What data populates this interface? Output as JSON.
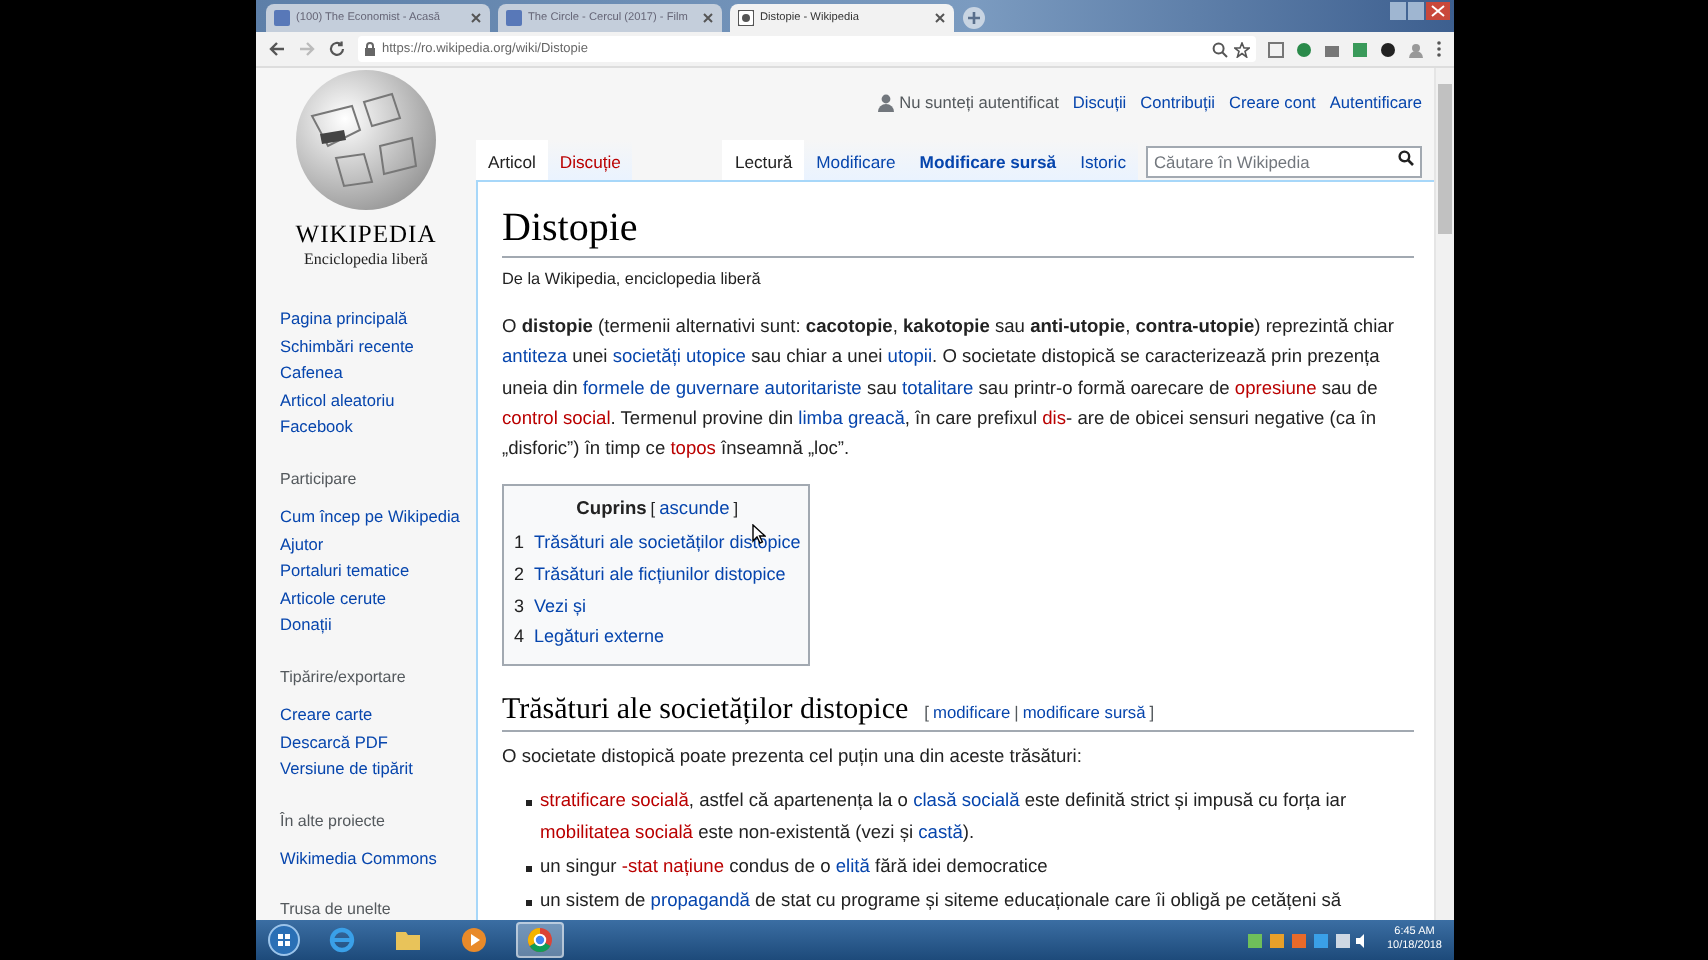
{
  "browser": {
    "tabs": [
      {
        "title": "(100) The Economist - Acasă",
        "selected": false
      },
      {
        "title": "The Circle - Cercul (2017) - Film",
        "selected": false
      },
      {
        "title": "Distopie - Wikipedia",
        "selected": true
      }
    ],
    "url": "https://ro.wikipedia.org/wiki/Distopie"
  },
  "logo": {
    "wordmark": "WIKIPEDIA",
    "tagline": "Enciclopedia liberă"
  },
  "sidebar": {
    "sections": [
      {
        "items": [
          "Pagina principală",
          "Schimbări recente",
          "Cafenea",
          "Articol aleatoriu",
          "Facebook"
        ]
      },
      {
        "heading": "Participare",
        "items": [
          "Cum încep pe Wikipedia",
          "Ajutor",
          "Portaluri tematice",
          "Articole cerute",
          "Donații"
        ]
      },
      {
        "heading": "Tipărire/exportare",
        "items": [
          "Creare carte",
          "Descarcă PDF",
          "Versiune de tipărit"
        ]
      },
      {
        "heading": "În alte proiecte",
        "items": [
          "Wikimedia Commons"
        ]
      },
      {
        "heading": "Trusa de unelte"
      }
    ]
  },
  "personal": {
    "status": "Nu sunteți autentificat",
    "links": [
      "Discuții",
      "Contribuții",
      "Creare cont",
      "Autentificare"
    ]
  },
  "namespace_tabs": [
    {
      "label": "Articol",
      "selected": true,
      "missing": false
    },
    {
      "label": "Discuție",
      "selected": false,
      "missing": true
    }
  ],
  "view_tabs": [
    {
      "label": "Lectură",
      "selected": true,
      "bold": false
    },
    {
      "label": "Modificare",
      "selected": false,
      "bold": false
    },
    {
      "label": "Modificare sursă",
      "selected": false,
      "bold": true
    },
    {
      "label": "Istoric",
      "selected": false,
      "bold": false
    }
  ],
  "search": {
    "placeholder": "Căutare în Wikipedia"
  },
  "article": {
    "title": "Distopie",
    "subtitle": "De la Wikipedia, enciclopedia liberă",
    "intro": [
      {
        "kind": "text",
        "text": "O "
      },
      {
        "kind": "bold",
        "text": "distopie"
      },
      {
        "kind": "text",
        "text": " (termenii alternativi sunt: "
      },
      {
        "kind": "bold",
        "text": "cacotopie"
      },
      {
        "kind": "text",
        "text": ", "
      },
      {
        "kind": "bold",
        "text": "kakotopie"
      },
      {
        "kind": "text",
        "text": " sau "
      },
      {
        "kind": "bold",
        "text": "anti-utopie"
      },
      {
        "kind": "text",
        "text": ", "
      },
      {
        "kind": "bold",
        "text": "contra-utopie"
      },
      {
        "kind": "text",
        "text": ") reprezintă chiar "
      },
      {
        "kind": "link",
        "text": "antiteza"
      },
      {
        "kind": "text",
        "text": " unei "
      },
      {
        "kind": "link",
        "text": "societăți utopice"
      },
      {
        "kind": "text",
        "text": " sau chiar a unei "
      },
      {
        "kind": "link",
        "text": "utopii"
      },
      {
        "kind": "text",
        "text": ". O societate distopică se caracterizează prin prezența uneia din "
      },
      {
        "kind": "link",
        "text": "formele de guvernare autoritariste"
      },
      {
        "kind": "text",
        "text": " sau "
      },
      {
        "kind": "link",
        "text": "totalitare"
      },
      {
        "kind": "text",
        "text": " sau printr-o formă oarecare de "
      },
      {
        "kind": "new",
        "text": "opresiune"
      },
      {
        "kind": "text",
        "text": " sau de "
      },
      {
        "kind": "new",
        "text": "control social"
      },
      {
        "kind": "text",
        "text": ". Termenul provine din "
      },
      {
        "kind": "link",
        "text": "limba greacă"
      },
      {
        "kind": "text",
        "text": ", în care prefixul "
      },
      {
        "kind": "new",
        "text": "dis"
      },
      {
        "kind": "text",
        "text": "- are de obicei sensuri negative (ca în „disforic”) în timp ce "
      },
      {
        "kind": "new",
        "text": "topos"
      },
      {
        "kind": "text",
        "text": " înseamnă „loc”."
      }
    ],
    "toc": {
      "title": "Cuprins",
      "open": "[",
      "toggle": "ascunde",
      "close": "]",
      "items": [
        {
          "number": "1",
          "text": "Trăsături ale societăților distopice"
        },
        {
          "number": "2",
          "text": "Trăsături ale ficțiunilor distopice"
        },
        {
          "number": "3",
          "text": "Vezi și"
        },
        {
          "number": "4",
          "text": "Legături externe"
        }
      ]
    },
    "section": {
      "heading": "Trăsături ale societăților distopice",
      "open": "[",
      "edit_links": [
        "modificare",
        "modificare sursă"
      ],
      "separator": "|",
      "close": "]",
      "lead": "O societate distopică poate prezenta cel puțin una din aceste trăsături:",
      "bullets": [
        [
          {
            "kind": "new",
            "text": "stratificare socială"
          },
          {
            "kind": "text",
            "text": ", astfel că apartenența la o "
          },
          {
            "kind": "link",
            "text": "clasă socială"
          },
          {
            "kind": "text",
            "text": " este definită strict și impusă cu forța iar "
          },
          {
            "kind": "new",
            "text": "mobilitatea socială"
          },
          {
            "kind": "text",
            "text": " este non-existentă (vezi și "
          },
          {
            "kind": "link",
            "text": "castă"
          },
          {
            "kind": "text",
            "text": ")."
          }
        ],
        [
          {
            "kind": "text",
            "text": "un singur "
          },
          {
            "kind": "new",
            "text": "-stat națiune"
          },
          {
            "kind": "text",
            "text": " condus de o "
          },
          {
            "kind": "link",
            "text": "elită"
          },
          {
            "kind": "text",
            "text": " fără idei democratice"
          }
        ],
        [
          {
            "kind": "text",
            "text": "un sistem de "
          },
          {
            "kind": "link",
            "text": "propagandă"
          },
          {
            "kind": "text",
            "text": " de stat cu programe și siteme educaționale care îi obligă pe cetățeni să"
          }
        ]
      ]
    }
  },
  "taskbar": {
    "apps": [
      {
        "kind": "ie",
        "selected": false
      },
      {
        "kind": "folder",
        "selected": false
      },
      {
        "kind": "media",
        "selected": false
      },
      {
        "kind": "chrome",
        "selected": true
      }
    ],
    "time": "6:45 AM",
    "date": "10/18/2018"
  }
}
